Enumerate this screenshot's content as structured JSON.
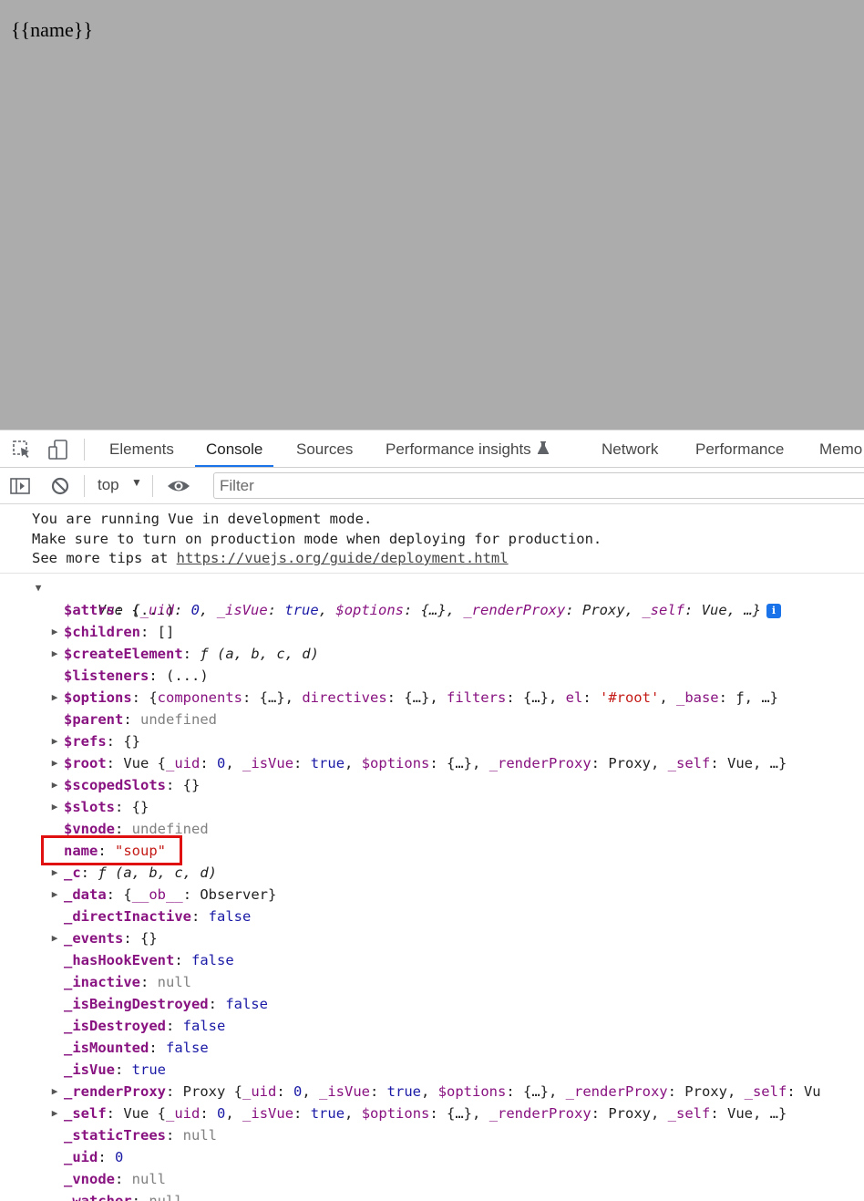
{
  "page": {
    "text": "{{name}}"
  },
  "devtools": {
    "tabs": [
      {
        "label": "Elements"
      },
      {
        "label": "Console",
        "active": true
      },
      {
        "label": "Sources"
      },
      {
        "label": "Performance insights"
      },
      {
        "label": "Network"
      },
      {
        "label": "Performance"
      },
      {
        "label": "Memo"
      }
    ],
    "toolbar": {
      "context": "top",
      "filter_placeholder": "Filter"
    }
  },
  "console": {
    "messages": [
      "You are running Vue in development mode.",
      "Make sure to turn on production mode when deploying for production.",
      "See more tips at "
    ],
    "link": "https://vuejs.org/guide/deployment.html",
    "object": {
      "summary_prefix": "Vue ",
      "summary": "{_uid: 0, _isVue: true, $options: {…}, _renderProxy: Proxy, _self: Vue, …}",
      "properties": [
        {
          "key": "$attrs",
          "value": "(...)",
          "expandable": false
        },
        {
          "key": "$children",
          "value": "[]",
          "expandable": true
        },
        {
          "key": "$createElement",
          "value": "ƒ (a, b, c, d)",
          "expandable": true
        },
        {
          "key": "$listeners",
          "value": "(...)",
          "expandable": false
        },
        {
          "key": "$options",
          "value": "{components: {…}, directives: {…}, filters: {…}, el: '#root', _base: ƒ, …}",
          "expandable": true
        },
        {
          "key": "$parent",
          "value": "undefined",
          "expandable": false
        },
        {
          "key": "$refs",
          "value": "{}",
          "expandable": true
        },
        {
          "key": "$root",
          "value": "Vue {_uid: 0, _isVue: true, $options: {…}, _renderProxy: Proxy, _self: Vue, …}",
          "expandable": true
        },
        {
          "key": "$scopedSlots",
          "value": "{}",
          "expandable": true
        },
        {
          "key": "$slots",
          "value": "{}",
          "expandable": true
        },
        {
          "key": "$vnode",
          "value": "undefined",
          "expandable": false
        },
        {
          "key": "name",
          "value": "\"soup\"",
          "expandable": false
        },
        {
          "key": "_c",
          "value": "ƒ (a, b, c, d)",
          "expandable": true
        },
        {
          "key": "_data",
          "value": "{__ob__: Observer}",
          "expandable": true
        },
        {
          "key": "_directInactive",
          "value": "false",
          "expandable": false
        },
        {
          "key": "_events",
          "value": "{}",
          "expandable": true
        },
        {
          "key": "_hasHookEvent",
          "value": "false",
          "expandable": false
        },
        {
          "key": "_inactive",
          "value": "null",
          "expandable": false
        },
        {
          "key": "_isBeingDestroyed",
          "value": "false",
          "expandable": false
        },
        {
          "key": "_isDestroyed",
          "value": "false",
          "expandable": false
        },
        {
          "key": "_isMounted",
          "value": "false",
          "expandable": false
        },
        {
          "key": "_isVue",
          "value": "true",
          "expandable": false
        },
        {
          "key": "_renderProxy",
          "value": "Proxy {_uid: 0, _isVue: true, $options: {…}, _renderProxy: Proxy, _self: Vu",
          "expandable": true
        },
        {
          "key": "_self",
          "value": "Vue {_uid: 0, _isVue: true, $options: {…}, _renderProxy: Proxy, _self: Vue, …}",
          "expandable": true
        },
        {
          "key": "_staticTrees",
          "value": "null",
          "expandable": false
        },
        {
          "key": "_uid",
          "value": "0",
          "expandable": false
        },
        {
          "key": "_vnode",
          "value": "null",
          "expandable": false
        },
        {
          "key": "_watcher",
          "value": "null",
          "expandable": false
        }
      ]
    }
  },
  "colors": {
    "page_bg": "#acacac",
    "active_tab": "#1a73e8",
    "highlight": "#e01010",
    "key": "#881280",
    "string": "#c41a16",
    "keyword": "#1a1aa6"
  }
}
